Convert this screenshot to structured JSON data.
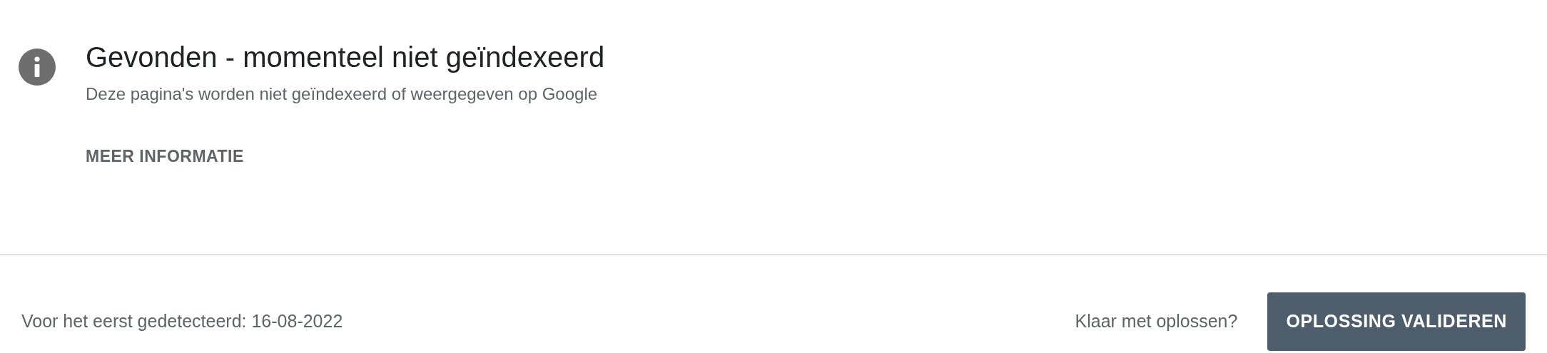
{
  "issue": {
    "title": "Gevonden - momenteel niet geïndexeerd",
    "description": "Deze pagina's worden niet geïndexeerd of weergegeven op Google",
    "link": "MEER INFORMATIE"
  },
  "footer": {
    "first_detected": "Voor het eerst gedetecteerd: 16-08-2022",
    "prompt": "Klaar met oplossen?",
    "button": "OPLOSSING VALIDEREN"
  }
}
